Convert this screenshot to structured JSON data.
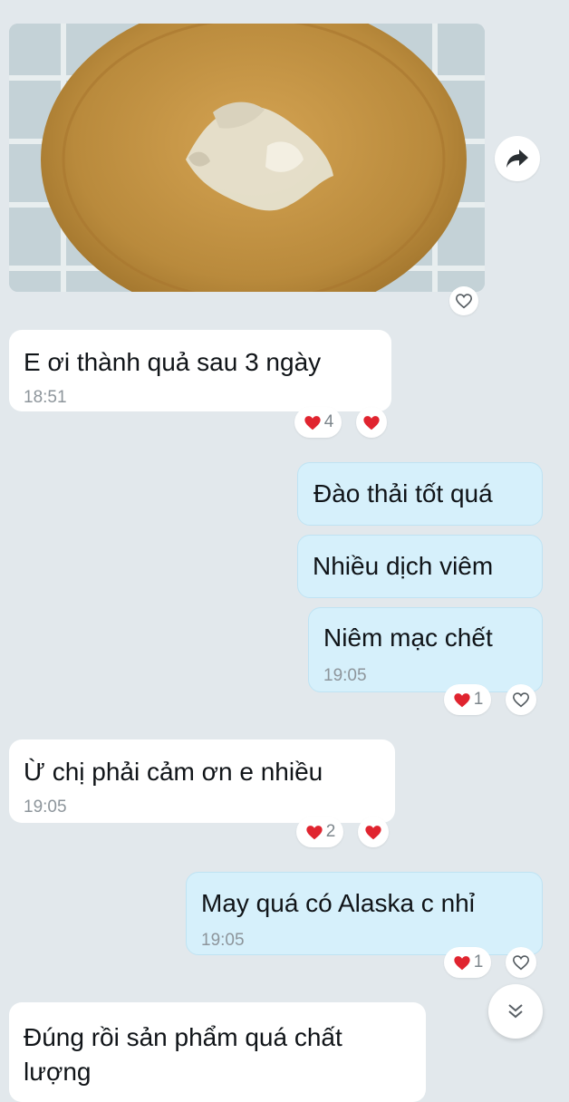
{
  "messages": [
    {
      "text": "E ơi thành quả sau 3 ngày",
      "time": "18:51",
      "reaction_count": "4"
    },
    {
      "text": "Đào thải tốt quá"
    },
    {
      "text": "Nhiều dịch viêm"
    },
    {
      "text": "Niêm mạc chết",
      "time": "19:05",
      "reaction_count": "1"
    },
    {
      "text": "Ừ chị phải cảm ơn e nhiều",
      "time": "19:05",
      "reaction_count": "2"
    },
    {
      "text": "May quá có Alaska c nhỉ",
      "time": "19:05",
      "reaction_count": "1"
    },
    {
      "text": "Đúng rồi sản phẩm quá chất lượng"
    }
  ],
  "icons": {
    "share": "share-arrow-icon",
    "heart_outline": "heart-outline-icon",
    "heart_filled": "heart-filled-icon",
    "scroll_down": "double-chevron-down-icon"
  },
  "colors": {
    "background": "#e2e8ec",
    "incoming_bubble": "#ffffff",
    "outgoing_bubble": "#d6f0fb",
    "heart": "#e0242f"
  }
}
